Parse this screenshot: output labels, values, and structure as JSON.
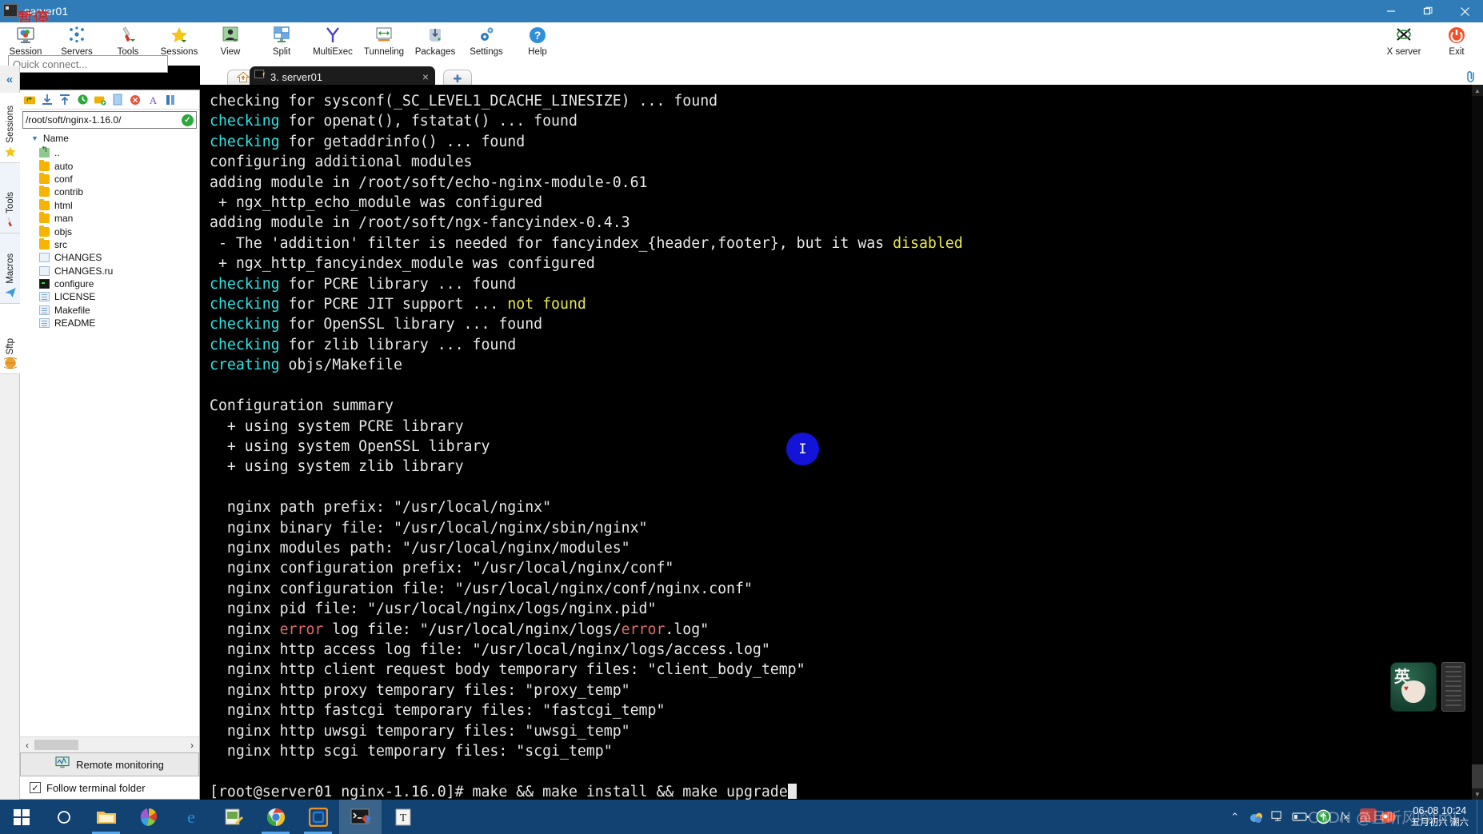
{
  "window": {
    "title": "server01",
    "watermark_overlay": "暂停",
    "minimize_label": "Minimize",
    "restore_label": "Restore",
    "close_label": "Close",
    "accent_color": "#2f7cb8"
  },
  "toolbar": {
    "items": [
      {
        "label": "Session",
        "icon": "session-icon"
      },
      {
        "label": "Servers",
        "icon": "servers-icon"
      },
      {
        "label": "Tools",
        "icon": "tools-icon"
      },
      {
        "label": "Sessions",
        "icon": "sessions-star-icon"
      },
      {
        "label": "View",
        "icon": "view-icon"
      },
      {
        "label": "Split",
        "icon": "split-icon"
      },
      {
        "label": "MultiExec",
        "icon": "multiexec-icon"
      },
      {
        "label": "Tunneling",
        "icon": "tunneling-icon"
      },
      {
        "label": "Packages",
        "icon": "packages-icon"
      },
      {
        "label": "Settings",
        "icon": "settings-gear-icon"
      },
      {
        "label": "Help",
        "icon": "help-question-icon"
      }
    ],
    "right_items": [
      {
        "label": "X server",
        "icon": "x-server-icon"
      },
      {
        "label": "Exit",
        "icon": "power-exit-icon"
      }
    ]
  },
  "quick_connect": {
    "placeholder": "Quick connect..."
  },
  "vertical_tabs": {
    "collapse_icon": "chevron-double-left-icon",
    "items": [
      {
        "label": "Sessions",
        "icon": "star-icon",
        "active": true
      },
      {
        "label": "Tools",
        "icon": "swiss-knife-icon",
        "active": false
      },
      {
        "label": "Macros",
        "icon": "paper-plane-icon",
        "active": false
      },
      {
        "label": "Sftp",
        "icon": "globe-icon",
        "active": true
      }
    ]
  },
  "sftp_panel": {
    "toolbar_icons": [
      "parent-folder-icon",
      "download-icon",
      "upload-icon",
      "refresh-icon",
      "new-folder-icon",
      "new-file-icon",
      "delete-icon",
      "font-icon",
      "view-list-icon"
    ],
    "path_value": "/root/soft/nginx-1.16.0/",
    "path_ok_icon": "check-circle-icon",
    "column_header": "Name",
    "sort_caret_icon": "caret-down-icon",
    "files": [
      {
        "name": "..",
        "type": "up"
      },
      {
        "name": "auto",
        "type": "folder"
      },
      {
        "name": "conf",
        "type": "folder"
      },
      {
        "name": "contrib",
        "type": "folder"
      },
      {
        "name": "html",
        "type": "folder"
      },
      {
        "name": "man",
        "type": "folder"
      },
      {
        "name": "objs",
        "type": "folder"
      },
      {
        "name": "src",
        "type": "folder"
      },
      {
        "name": "CHANGES",
        "type": "doc"
      },
      {
        "name": "CHANGES.ru",
        "type": "doc"
      },
      {
        "name": "configure",
        "type": "exe"
      },
      {
        "name": "LICENSE",
        "type": "doclines"
      },
      {
        "name": "Makefile",
        "type": "doclines"
      },
      {
        "name": "README",
        "type": "doclines"
      }
    ],
    "remote_monitoring_label": "Remote monitoring",
    "remote_monitoring_icon": "monitor-graph-icon",
    "follow_label": "Follow terminal folder",
    "follow_checked": true,
    "check_glyph": "✓",
    "scroll_left_glyph": "‹",
    "scroll_right_glyph": "›"
  },
  "tabbar": {
    "home_icon": "home-icon",
    "active_tab": {
      "label": "3. server01",
      "icon": "terminal-pencil-icon",
      "close_glyph": "×"
    },
    "new_tab_glyph": "✚",
    "link_icon": "paperclip-icon"
  },
  "terminal": {
    "blue_dot_label": "I",
    "cursor": true,
    "scroll_up_glyph": "▲",
    "scroll_down_glyph": "▼",
    "lines": [
      [
        {
          "t": "checking for sysconf(_SC_LEVEL1_DCACHE_LINESIZE) ... found",
          "c": "white"
        }
      ],
      [
        {
          "t": "checking",
          "c": "cyan"
        },
        {
          "t": " for openat(), fstatat() ... found",
          "c": "white"
        }
      ],
      [
        {
          "t": "checking",
          "c": "cyan"
        },
        {
          "t": " for getaddrinfo() ... found",
          "c": "white"
        }
      ],
      [
        {
          "t": "configuring additional modules",
          "c": "white"
        }
      ],
      [
        {
          "t": "adding module in /root/soft/echo-nginx-module-0.61",
          "c": "white"
        }
      ],
      [
        {
          "t": " + ngx_http_echo_module was configured",
          "c": "white"
        }
      ],
      [
        {
          "t": "adding module in /root/soft/ngx-fancyindex-0.4.3",
          "c": "white"
        }
      ],
      [
        {
          "t": " - The 'addition' filter is needed for fancyindex_{header,footer}, but it was ",
          "c": "white"
        },
        {
          "t": "disabled",
          "c": "yellow"
        }
      ],
      [
        {
          "t": " + ngx_http_fancyindex_module was configured",
          "c": "white"
        }
      ],
      [
        {
          "t": "checking",
          "c": "cyan"
        },
        {
          "t": " for PCRE library ... found",
          "c": "white"
        }
      ],
      [
        {
          "t": "checking",
          "c": "cyan"
        },
        {
          "t": " for PCRE JIT support ... ",
          "c": "white"
        },
        {
          "t": "not found",
          "c": "yellow"
        }
      ],
      [
        {
          "t": "checking",
          "c": "cyan"
        },
        {
          "t": " for OpenSSL library ... found",
          "c": "white"
        }
      ],
      [
        {
          "t": "checking",
          "c": "cyan"
        },
        {
          "t": " for zlib library ... found",
          "c": "white"
        }
      ],
      [
        {
          "t": "creating",
          "c": "cyan"
        },
        {
          "t": " objs/Makefile",
          "c": "white"
        }
      ],
      [
        {
          "t": "",
          "c": "white"
        }
      ],
      [
        {
          "t": "Configuration summary",
          "c": "white"
        }
      ],
      [
        {
          "t": "  + using system PCRE library",
          "c": "white"
        }
      ],
      [
        {
          "t": "  + using system OpenSSL library",
          "c": "white"
        }
      ],
      [
        {
          "t": "  + using system zlib library",
          "c": "white"
        }
      ],
      [
        {
          "t": "",
          "c": "white"
        }
      ],
      [
        {
          "t": "  nginx path prefix: \"/usr/local/nginx\"",
          "c": "white"
        }
      ],
      [
        {
          "t": "  nginx binary file: \"/usr/local/nginx/sbin/nginx\"",
          "c": "white"
        }
      ],
      [
        {
          "t": "  nginx modules path: \"/usr/local/nginx/modules\"",
          "c": "white"
        }
      ],
      [
        {
          "t": "  nginx configuration prefix: \"/usr/local/nginx/conf\"",
          "c": "white"
        }
      ],
      [
        {
          "t": "  nginx configuration file: \"/usr/local/nginx/conf/nginx.conf\"",
          "c": "white"
        }
      ],
      [
        {
          "t": "  nginx pid file: \"/usr/local/nginx/logs/nginx.pid\"",
          "c": "white"
        }
      ],
      [
        {
          "t": "  nginx ",
          "c": "white"
        },
        {
          "t": "error",
          "c": "red"
        },
        {
          "t": " log file: \"/usr/local/nginx/logs/",
          "c": "white"
        },
        {
          "t": "error",
          "c": "red"
        },
        {
          "t": ".log\"",
          "c": "white"
        }
      ],
      [
        {
          "t": "  nginx http access log file: \"/usr/local/nginx/logs/access.log\"",
          "c": "white"
        }
      ],
      [
        {
          "t": "  nginx http client request body temporary files: \"client_body_temp\"",
          "c": "white"
        }
      ],
      [
        {
          "t": "  nginx http proxy temporary files: \"proxy_temp\"",
          "c": "white"
        }
      ],
      [
        {
          "t": "  nginx http fastcgi temporary files: \"fastcgi_temp\"",
          "c": "white"
        }
      ],
      [
        {
          "t": "  nginx http uwsgi temporary files: \"uwsgi_temp\"",
          "c": "white"
        }
      ],
      [
        {
          "t": "  nginx http scgi temporary files: \"scgi_temp\"",
          "c": "white"
        }
      ],
      [
        {
          "t": "",
          "c": "white"
        }
      ],
      [
        {
          "t": "[root@server01 nginx-1.16.0]# make && make install && make upgrade",
          "c": "white"
        },
        {
          "t": "CURSOR",
          "c": "cursor"
        }
      ]
    ],
    "colors": {
      "background": "#000000",
      "foreground": "#e8e8e8",
      "cyan": "#2ee6e6",
      "yellow": "#e8e84a",
      "red": "#e06c6c"
    }
  },
  "taskbar": {
    "items": [
      {
        "icon": "windows-start-icon",
        "name": "start-button",
        "state": "none"
      },
      {
        "icon": "cortana-circle-icon",
        "name": "search-button",
        "state": "none"
      },
      {
        "icon": "file-explorer-icon",
        "name": "file-explorer",
        "state": "running"
      },
      {
        "icon": "pinwheel-icon",
        "name": "photos-app",
        "state": "none"
      },
      {
        "icon": "edge-icon",
        "name": "edge-browser",
        "state": "none"
      },
      {
        "icon": "notepad-image-icon",
        "name": "editor-app",
        "state": "none"
      },
      {
        "icon": "chrome-icon",
        "name": "chrome-browser",
        "state": "running"
      },
      {
        "icon": "vmware-icon",
        "name": "vmware-workstation",
        "state": "running"
      },
      {
        "icon": "mobaxterm-icon",
        "name": "mobaxterm",
        "state": "active"
      },
      {
        "icon": "typora-icon",
        "name": "typora-app",
        "state": "none"
      }
    ],
    "tray": [
      {
        "icon": "chevron-up-icon",
        "name": "show-hidden-icons",
        "label": "⌃"
      },
      {
        "icon": "cloud-onedrive-icon",
        "name": "onedrive-tray",
        "label": ""
      },
      {
        "icon": "network-icon",
        "name": "network-tray",
        "label": ""
      },
      {
        "icon": "battery-icon",
        "name": "battery-tray",
        "label": ""
      },
      {
        "icon": "update-arrow-icon",
        "name": "update-tray",
        "label": ""
      },
      {
        "icon": "volume-muted-icon",
        "name": "volume-tray",
        "label": "⧸×"
      },
      {
        "icon": "ime-english-icon",
        "name": "ime-mode",
        "label": "英"
      },
      {
        "icon": "ime-logo-icon",
        "name": "ime-logo",
        "label": ""
      }
    ],
    "clock_line1": "06-08 10:24",
    "clock_line2": "五月初六 潮六",
    "watermark": "CSDN @且听风吟tmj"
  }
}
